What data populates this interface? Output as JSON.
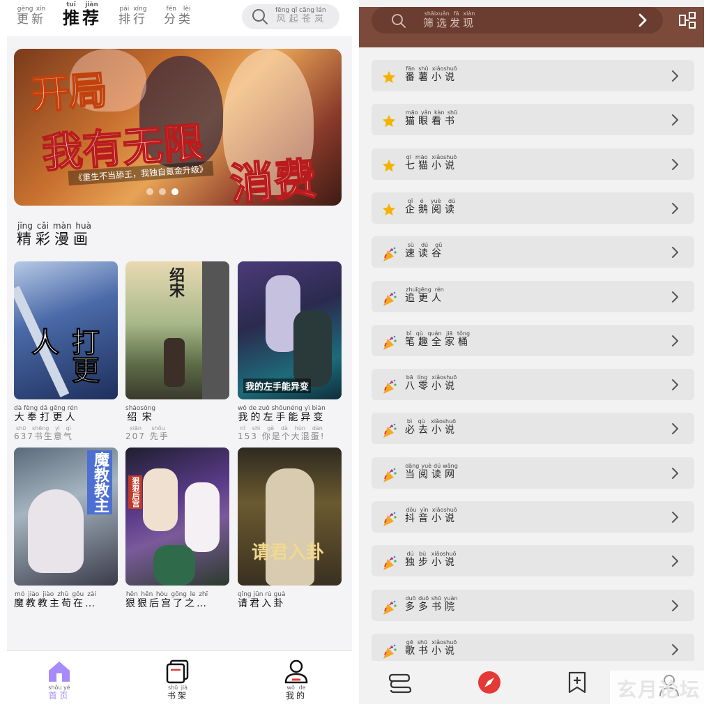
{
  "left": {
    "tabs": [
      {
        "label": "更新",
        "pinyin": "gèng xīn"
      },
      {
        "label": "推荐",
        "pinyin": "tuī jiàn"
      },
      {
        "label": "排行",
        "pinyin": "pái xíng"
      },
      {
        "label": "分类",
        "pinyin": "fēn lèi"
      }
    ],
    "search_placeholder": "风起苍岚",
    "search_pinyin": "fēng qǐ cāng lán",
    "banner": {
      "line1": "开局",
      "line2": "我有无限",
      "line3": "消费",
      "subtitle": "《重生不当舔王，我独自氪金升级》",
      "dots": 3,
      "active_dot": 2
    },
    "section_title": "精彩漫画",
    "section_pinyin": "jīng cǎi màn huà",
    "comics": [
      {
        "title": "大奉打更人",
        "pinyin": "dà fèng dǎ gēng rén",
        "meta": "637书生意气",
        "meta_pinyin": "shū shēng yì qì",
        "cover_text": "打更人"
      },
      {
        "title": "绍宋",
        "pinyin": "shàosòng",
        "meta": "207 先手",
        "meta_pinyin": "xiān shǒu",
        "cover_text": "绍宋"
      },
      {
        "title": "我的左手能异变",
        "pinyin": "wǒ de zuǒ shǒunéng yì biàn",
        "meta": "153 你是个大混蛋!",
        "meta_pinyin": "nǐ shì gè dà hùn dàn",
        "cover_text": "我的左手能异变"
      },
      {
        "title": "魔教教主苟在…",
        "pinyin": "mó jiào jiào zhǔ gǒu zài",
        "meta": "",
        "meta_pinyin": "",
        "cover_text": "魔教教主"
      },
      {
        "title": "狠狠后宫了之…",
        "pinyin": "hěn hěn hòu gōng le zhī",
        "meta": "",
        "meta_pinyin": "",
        "cover_text": "狠狠后宫"
      },
      {
        "title": "请君入卦",
        "pinyin": "qǐng jūn rù guà",
        "meta": "",
        "meta_pinyin": "",
        "cover_text": "请君入卦"
      }
    ],
    "nav": [
      {
        "label": "首页",
        "pinyin": "shǒu yè"
      },
      {
        "label": "书架",
        "pinyin": "shū jià"
      },
      {
        "label": "我的",
        "pinyin": "wǒ de"
      }
    ]
  },
  "right": {
    "search_placeholder": "筛选发现",
    "search_pinyin": "shāixuǎn fā xiàn",
    "sites": [
      {
        "name": "番薯小说",
        "pinyin": "fān shǔ xiǎoshuō",
        "icon": "star-icon"
      },
      {
        "name": "猫眼看书",
        "pinyin": "māo yǎn kàn shū",
        "icon": "star-icon"
      },
      {
        "name": "七猫小说",
        "pinyin": "qī māo xiǎoshuō",
        "icon": "star-icon"
      },
      {
        "name": "企鹅阅读",
        "pinyin": "qǐ é yuè dú",
        "icon": "star-icon"
      },
      {
        "name": "速读谷",
        "pinyin": "sù dú gǔ",
        "icon": "party-popper-icon"
      },
      {
        "name": "追更人",
        "pinyin": "zhuīgēng rén",
        "icon": "party-popper-icon"
      },
      {
        "name": "笔趣全家桶",
        "pinyin": "bǐ qù quán jiā tǒng",
        "icon": "party-popper-icon"
      },
      {
        "name": "八零小说",
        "pinyin": "bā líng xiǎoshuō",
        "icon": "party-popper-icon"
      },
      {
        "name": "必去小说",
        "pinyin": "bì qù xiǎoshuō",
        "icon": "party-popper-icon"
      },
      {
        "name": "当阅读网",
        "pinyin": "dāng yuè dú wǎng",
        "icon": "party-popper-icon"
      },
      {
        "name": "抖音小说",
        "pinyin": "dǒu yīn xiǎoshuō",
        "icon": "party-popper-icon"
      },
      {
        "name": "独步小说",
        "pinyin": "dú bù xiǎoshuō",
        "icon": "party-popper-icon"
      },
      {
        "name": "多多书院",
        "pinyin": "duō duō shū yuàn",
        "icon": "party-popper-icon"
      },
      {
        "name": "歌书小说",
        "pinyin": "gē shū xiǎoshuō",
        "icon": "party-popper-icon"
      }
    ],
    "watermark": "玄月论坛"
  },
  "colors": {
    "accent_purple": "#a78bfa",
    "header_brown": "#7b4a3a",
    "compass_red": "#e53935"
  }
}
